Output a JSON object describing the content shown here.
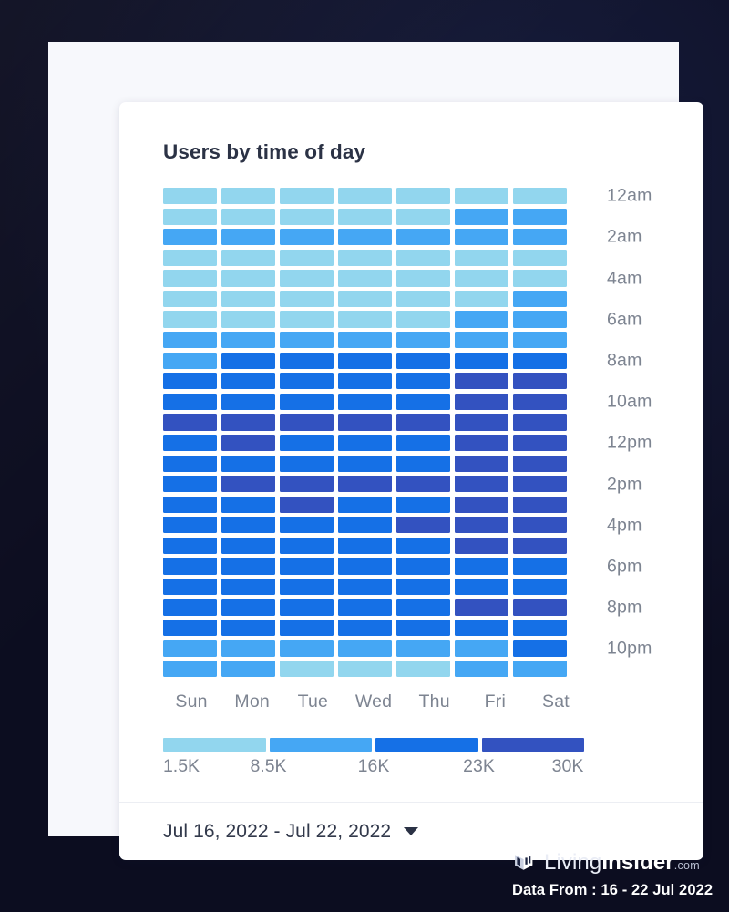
{
  "chart": {
    "title": "Users by time of day"
  },
  "footer": {
    "date_range": "Jul 16, 2022 - Jul 22, 2022",
    "caret_icon": "chevron-down-icon"
  },
  "branding": {
    "logo_icon": "house-cube-logo-icon",
    "name_light": "Living",
    "name_bold": "Insider",
    "name_suffix": ".com",
    "data_from": "Data From : 16 - 22 Jul 2022"
  },
  "colors": {
    "level_1": "#92d6ee",
    "level_2": "#45a7f4",
    "level_3": "#1570e6",
    "level_4": "#3352c0",
    "background": "#0c0d20",
    "frame": "#f7f8fc",
    "card": "#ffffff",
    "axis_text": "#7d8491",
    "title_text": "#2b3245"
  },
  "chart_data": {
    "type": "heatmap",
    "title": "Users by time of day",
    "xlabel": "",
    "ylabel": "",
    "grid": false,
    "legend_position": "bottom",
    "categories": [
      "Sun",
      "Mon",
      "Tue",
      "Wed",
      "Thu",
      "Fri",
      "Sat"
    ],
    "y_categories": [
      "12am",
      "1am",
      "2am",
      "3am",
      "4am",
      "5am",
      "6am",
      "7am",
      "8am",
      "9am",
      "10am",
      "11am",
      "12pm",
      "1pm",
      "2pm",
      "3pm",
      "4pm",
      "5pm",
      "6pm",
      "7pm",
      "8pm",
      "9pm",
      "10pm",
      "11pm"
    ],
    "y_tick_labels": [
      "12am",
      "2am",
      "4am",
      "6am",
      "8am",
      "10am",
      "12pm",
      "2pm",
      "4pm",
      "6pm",
      "8pm",
      "10pm"
    ],
    "legend": {
      "tick_labels": [
        "1.5K",
        "8.5K",
        "16K",
        "23K",
        "30K"
      ],
      "swatch_colors": [
        "#92d6ee",
        "#45a7f4",
        "#1570e6",
        "#3352c0"
      ],
      "bin_ranges": [
        [
          1500,
          8500
        ],
        [
          8500,
          16000
        ],
        [
          16000,
          23000
        ],
        [
          23000,
          30000
        ]
      ]
    },
    "value_scale_min": 1500,
    "value_scale_max": 30000,
    "levels": [
      [
        1,
        1,
        1,
        1,
        1,
        1,
        1
      ],
      [
        1,
        1,
        1,
        1,
        1,
        2,
        2
      ],
      [
        2,
        2,
        2,
        2,
        2,
        2,
        2
      ],
      [
        1,
        1,
        1,
        1,
        1,
        1,
        1
      ],
      [
        1,
        1,
        1,
        1,
        1,
        1,
        1
      ],
      [
        1,
        1,
        1,
        1,
        1,
        1,
        2
      ],
      [
        1,
        1,
        1,
        1,
        1,
        2,
        2
      ],
      [
        2,
        2,
        2,
        2,
        2,
        2,
        2
      ],
      [
        2,
        3,
        3,
        3,
        3,
        3,
        3
      ],
      [
        3,
        3,
        3,
        3,
        3,
        4,
        4
      ],
      [
        3,
        3,
        3,
        3,
        3,
        4,
        4
      ],
      [
        4,
        4,
        4,
        4,
        4,
        4,
        4
      ],
      [
        3,
        4,
        3,
        3,
        3,
        4,
        4
      ],
      [
        3,
        3,
        3,
        3,
        3,
        4,
        4
      ],
      [
        3,
        4,
        4,
        4,
        4,
        4,
        4
      ],
      [
        3,
        3,
        4,
        3,
        3,
        4,
        4
      ],
      [
        3,
        3,
        3,
        3,
        4,
        4,
        4
      ],
      [
        3,
        3,
        3,
        3,
        3,
        4,
        4
      ],
      [
        3,
        3,
        3,
        3,
        3,
        3,
        3
      ],
      [
        3,
        3,
        3,
        3,
        3,
        3,
        3
      ],
      [
        3,
        3,
        3,
        3,
        3,
        4,
        4
      ],
      [
        3,
        3,
        3,
        3,
        3,
        3,
        3
      ],
      [
        2,
        2,
        2,
        2,
        2,
        2,
        3
      ],
      [
        2,
        2,
        1,
        1,
        1,
        2,
        2
      ]
    ]
  }
}
